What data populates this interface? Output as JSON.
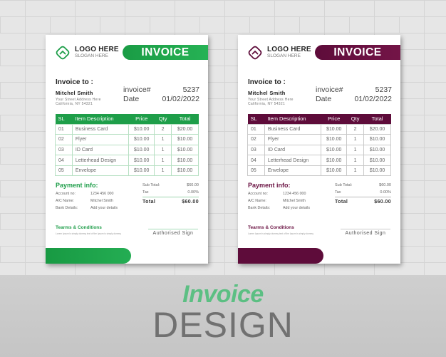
{
  "headline": {
    "top": "Invoice",
    "bottom": "DESIGN",
    "top_color": "#5cbf83",
    "bottom_color": "#717171"
  },
  "invoices": [
    {
      "theme": "green",
      "accent": "#1e9e49",
      "logo": {
        "icon": "chevron-diamond-logo",
        "title": "LOGO HERE",
        "slogan": "SLOGAN HERE"
      },
      "title": "INVOICE",
      "bill_to": {
        "label": "Invoice to :",
        "name": "Mitchel Smith",
        "address_line1": "Your Street Address Here",
        "address_line2": "California, NY 54321"
      },
      "meta": {
        "invoice_label": "invoice#",
        "invoice_number": "5237",
        "date_label": "Date",
        "date": "01/02/2022"
      },
      "table": {
        "headers": [
          "SL",
          "Item Description",
          "Price",
          "Qty",
          "Total"
        ],
        "rows": [
          [
            "01",
            "Business Card",
            "$10.00",
            "2",
            "$20.00"
          ],
          [
            "02",
            "Flyer",
            "$10.00",
            "1",
            "$10.00"
          ],
          [
            "03",
            "ID Card",
            "$10.00",
            "1",
            "$10.00"
          ],
          [
            "04",
            "Letterhead Design",
            "$10.00",
            "1",
            "$10.00"
          ],
          [
            "05",
            "Envelope",
            "$10.00",
            "1",
            "$10.00"
          ]
        ]
      },
      "payment": {
        "title": "Payment info:",
        "account_label": "Account no:",
        "account_value": "1234 456 000",
        "name_label": "A/C Name:",
        "name_value": "Mitchel Smith",
        "bank_label": "Bank Details:",
        "bank_value": "Add your details"
      },
      "totals": {
        "subtotal_label": "Sub Total:",
        "subtotal_value": "$60.00",
        "tax_label": "Tax",
        "tax_value": "0.00%",
        "total_label": "Total",
        "total_value": "$60.00"
      },
      "terms": {
        "title": "Tearms & Conditions",
        "text": "Lorem Ipsum is simply dummy text of the Ipsum is simply dummy"
      },
      "sign_label": "Authorised Sign"
    },
    {
      "theme": "maroon",
      "accent": "#5e0c3a",
      "logo": {
        "icon": "chevron-diamond-logo",
        "title": "LOGO HERE",
        "slogan": "SLOGAN HERE"
      },
      "title": "INVOICE",
      "bill_to": {
        "label": "Invoice to :",
        "name": "Mitchel Smith",
        "address_line1": "Your Street Address Here",
        "address_line2": "California, NY 54321"
      },
      "meta": {
        "invoice_label": "invoice#",
        "invoice_number": "5237",
        "date_label": "Date",
        "date": "01/02/2022"
      },
      "table": {
        "headers": [
          "SL",
          "Item Description",
          "Price",
          "Qty",
          "Total"
        ],
        "rows": [
          [
            "01",
            "Business Card",
            "$10.00",
            "2",
            "$20.00"
          ],
          [
            "02",
            "Flyer",
            "$10.00",
            "1",
            "$10.00"
          ],
          [
            "03",
            "ID Card",
            "$10.00",
            "1",
            "$10.00"
          ],
          [
            "04",
            "Letterhead Design",
            "$10.00",
            "1",
            "$10.00"
          ],
          [
            "05",
            "Envelope",
            "$10.00",
            "1",
            "$10.00"
          ]
        ]
      },
      "payment": {
        "title": "Payment info:",
        "account_label": "Account no:",
        "account_value": "1234 456 000",
        "name_label": "A/C Name:",
        "name_value": "Mitchel Smith",
        "bank_label": "Bank Details:",
        "bank_value": "Add your details"
      },
      "totals": {
        "subtotal_label": "Sub Total:",
        "subtotal_value": "$60.00",
        "tax_label": "Tax",
        "tax_value": "0.00%",
        "total_label": "Total",
        "total_value": "$60.00"
      },
      "terms": {
        "title": "Tearms & Conditions",
        "text": "Lorem Ipsum is simply dummy text of the Ipsum is simply dummy"
      },
      "sign_label": "Authorised Sign"
    }
  ]
}
